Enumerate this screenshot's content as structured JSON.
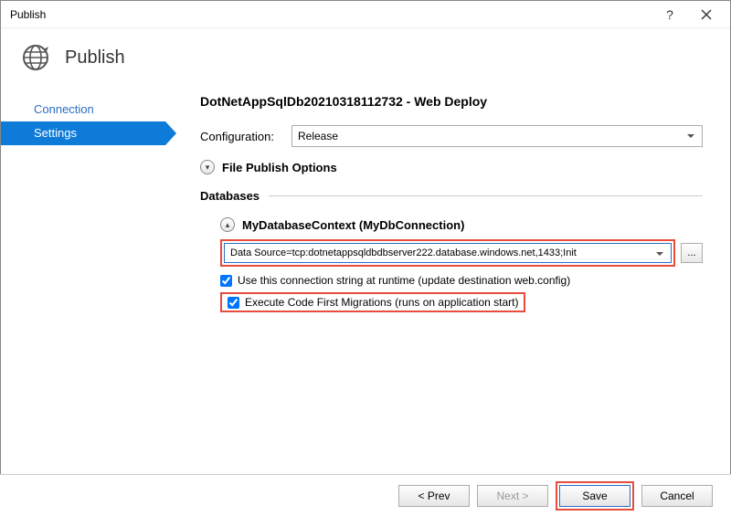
{
  "window": {
    "title": "Publish"
  },
  "header": {
    "title": "Publish"
  },
  "nav": {
    "items": [
      {
        "label": "Connection",
        "active": false
      },
      {
        "label": "Settings",
        "active": true
      }
    ]
  },
  "content": {
    "page_title": "DotNetAppSqlDb20210318112732 - Web Deploy",
    "config_label": "Configuration:",
    "config_value": "Release",
    "file_publish_label": "File Publish Options",
    "databases_label": "Databases",
    "db_context_label": "MyDatabaseContext (MyDbConnection)",
    "conn_string": "Data Source=tcp:dotnetappsqldbdbserver222.database.windows.net,1433;Init",
    "ellipsis": "...",
    "chk1_label": "Use this connection string at runtime (update destination web.config)",
    "chk2_label": "Execute Code First Migrations (runs on application start)"
  },
  "footer": {
    "prev": "< Prev",
    "next": "Next >",
    "save": "Save",
    "cancel": "Cancel"
  },
  "icons": {
    "chevron_down": "▾",
    "chevron_up": "▴"
  }
}
